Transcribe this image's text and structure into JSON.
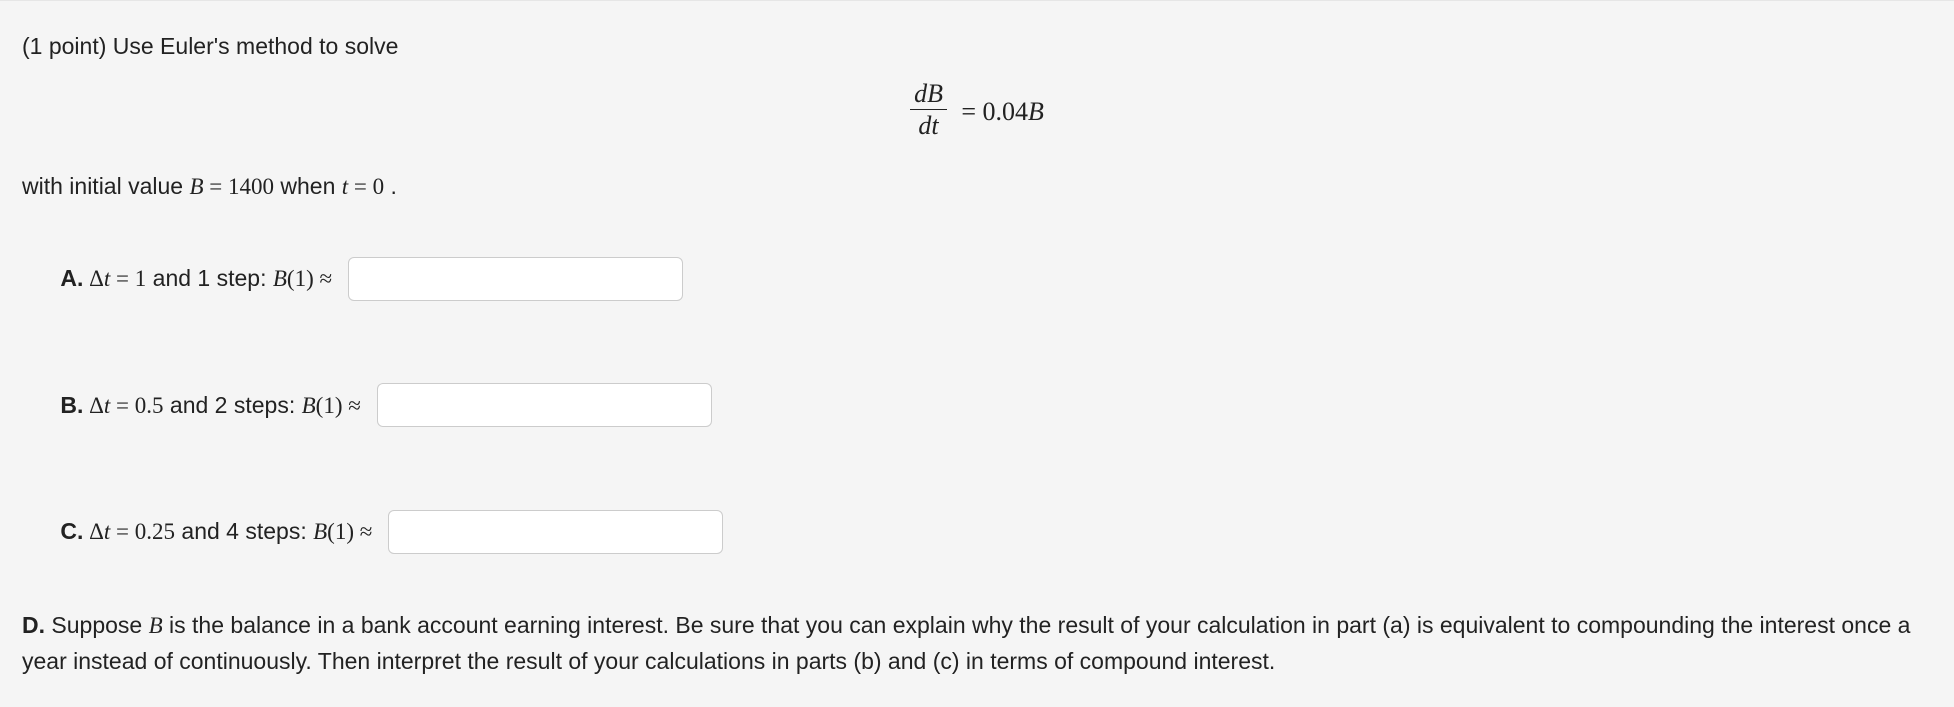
{
  "intro": {
    "points_prefix": "(1 point) ",
    "text": "Use Euler's method to solve"
  },
  "equation": {
    "num_d": "d",
    "num_var": "B",
    "den_d": "d",
    "den_var": "t",
    "equals": " = ",
    "rhs_coef": "0.04",
    "rhs_var": "B"
  },
  "initial": {
    "pre": "with initial value ",
    "B": "B",
    "eq": " = ",
    "Bval": "1400",
    "mid": " when ",
    "t": "t",
    "eq2": " = ",
    "tval": "0",
    "post": " ."
  },
  "parts": {
    "A": {
      "label": "A.",
      "dt_sym": " Δ",
      "t": "t",
      "eq": " = ",
      "dtval": "1",
      "mid": " and 1 step: ",
      "B": "B",
      "paren_open": "(",
      "arg": "1",
      "paren_close": ")",
      "approx": " ≈ ",
      "value": ""
    },
    "B": {
      "label": "B.",
      "dt_sym": " Δ",
      "t": "t",
      "eq": " = ",
      "dtval": "0.5",
      "mid": " and 2 steps: ",
      "B": "B",
      "paren_open": "(",
      "arg": "1",
      "paren_close": ")",
      "approx": " ≈ ",
      "value": ""
    },
    "C": {
      "label": "C.",
      "dt_sym": " Δ",
      "t": "t",
      "eq": " = ",
      "dtval": "0.25",
      "mid": " and 4 steps: ",
      "B": "B",
      "paren_open": "(",
      "arg": "1",
      "paren_close": ")",
      "approx": " ≈ ",
      "value": ""
    },
    "D": {
      "label": "D.",
      "pre": " Suppose ",
      "B": "B",
      "text": " is the balance in a bank account earning interest. Be sure that you can explain why the result of your calculation in part (a) is equivalent to compounding the interest once a year instead of continuously. Then interpret the result of your calculations in parts (b) and (c) in terms of compound interest."
    }
  }
}
